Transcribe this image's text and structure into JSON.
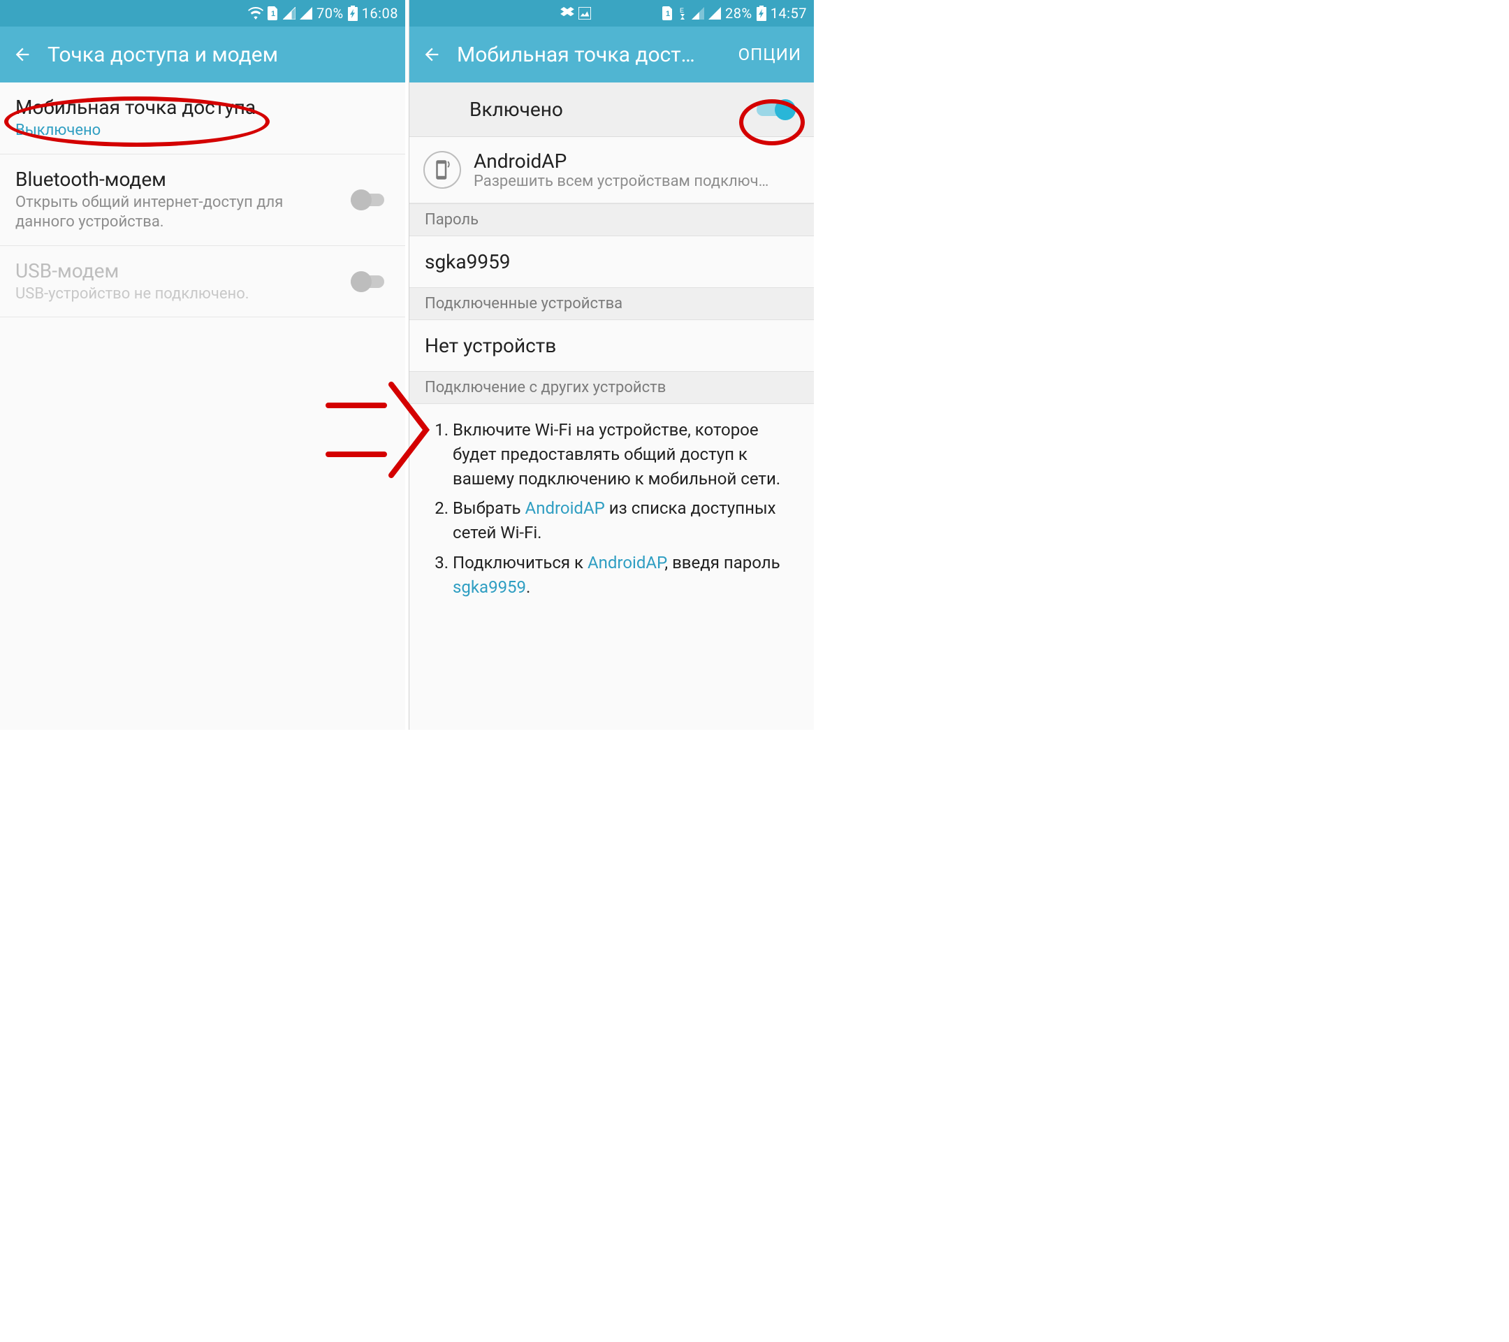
{
  "left": {
    "status": {
      "battery": "70%",
      "time": "16:08"
    },
    "appbar": {
      "title": "Точка доступа и модем"
    },
    "rows": {
      "hotspot": {
        "title": "Мобильная точка доступа",
        "state": "Выключено"
      },
      "bt": {
        "title": "Bluetooth-модем",
        "sub": "Открыть общий интернет-доступ для данного устройства."
      },
      "usb": {
        "title": "USB-модем",
        "sub": "USB-устройство не подключено."
      }
    }
  },
  "right": {
    "status": {
      "battery": "28%",
      "time": "14:57"
    },
    "appbar": {
      "title": "Мобильная точка дост…",
      "options": "ОПЦИИ"
    },
    "toggle": {
      "label": "Включено"
    },
    "network": {
      "ssid": "AndroidAP",
      "sub": "Разрешить всем устройствам подключ…"
    },
    "sections": {
      "password": "Пароль",
      "connected": "Подключенные устройства",
      "howto": "Подключение с других устройств"
    },
    "password": "sgka9959",
    "no_devices": "Нет устройств",
    "instr": {
      "s1a": "Включите Wi-Fi на устройстве, которое будет предоставлять общий доступ к вашему подключению к мобильной сети.",
      "s2a": "Выбрать ",
      "s2b": "AndroidAP",
      "s2c": " из списка доступных сетей Wi-Fi.",
      "s3a": "Подключиться к ",
      "s3b": "AndroidAP",
      "s3c": ", введя пароль ",
      "s3d": "sgka9959",
      "s3e": "."
    }
  }
}
